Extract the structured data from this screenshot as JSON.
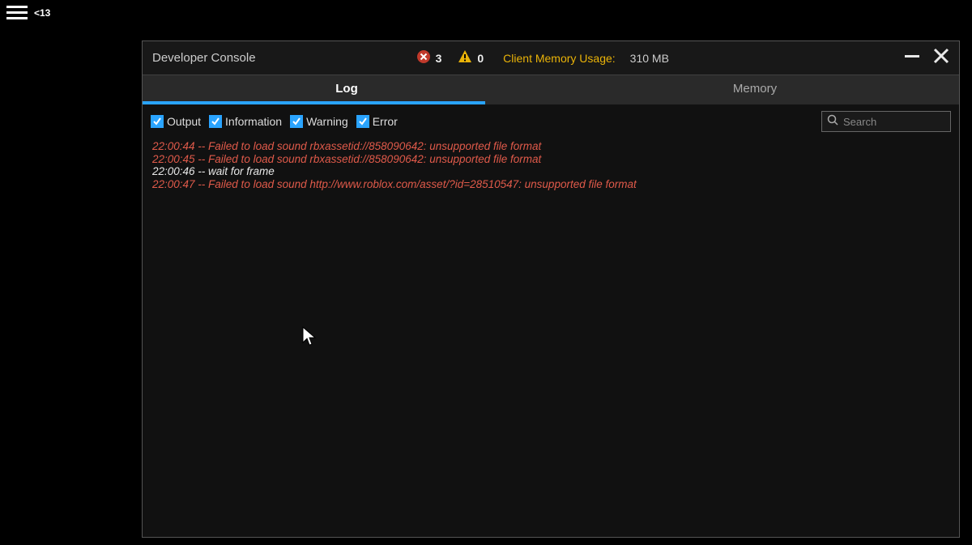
{
  "topbar": {
    "age_label": "<13"
  },
  "window": {
    "title": "Developer Console",
    "error_count": "3",
    "warning_count": "0",
    "memory_label": "Client Memory Usage:",
    "memory_value": "310 MB"
  },
  "tabs": {
    "log": {
      "label": "Log",
      "active": true
    },
    "memory": {
      "label": "Memory",
      "active": false
    }
  },
  "filters": {
    "output": "Output",
    "information": "Information",
    "warning": "Warning",
    "error": "Error"
  },
  "search": {
    "placeholder": "Search"
  },
  "log": [
    {
      "kind": "err",
      "text": "22:00:44 -- Failed to load sound rbxassetid://858090642: unsupported file format"
    },
    {
      "kind": "err",
      "text": "22:00:45 -- Failed to load sound rbxassetid://858090642: unsupported file format"
    },
    {
      "kind": "info",
      "text": "22:00:46 -- wait for frame"
    },
    {
      "kind": "err",
      "text": "22:00:47 -- Failed to load sound http://www.roblox.com/asset/?id=28510547: unsupported file format"
    }
  ]
}
